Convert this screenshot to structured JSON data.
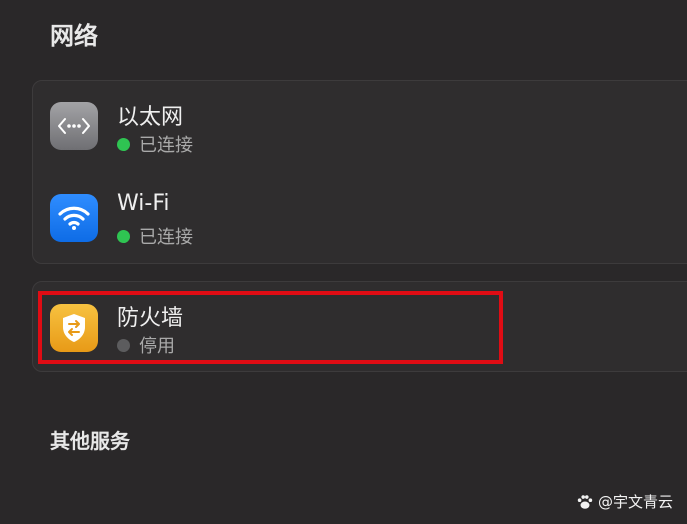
{
  "network": {
    "title": "网络",
    "items": [
      {
        "name": "以太网",
        "status": "已连接",
        "status_color": "#2fc452",
        "icon": "ethernet-icon"
      },
      {
        "name": "Wi-Fi",
        "status": "已连接",
        "status_color": "#2fc452",
        "icon": "wifi-icon"
      }
    ]
  },
  "firewall": {
    "name": "防火墙",
    "status": "停用",
    "status_color": "#5c5c5e",
    "icon": "firewall-shield-icon"
  },
  "other_services": {
    "title": "其他服务"
  },
  "watermark": {
    "text": "@宇文青云"
  },
  "colors": {
    "background": "#2a2829",
    "highlight": "#e00c14"
  }
}
